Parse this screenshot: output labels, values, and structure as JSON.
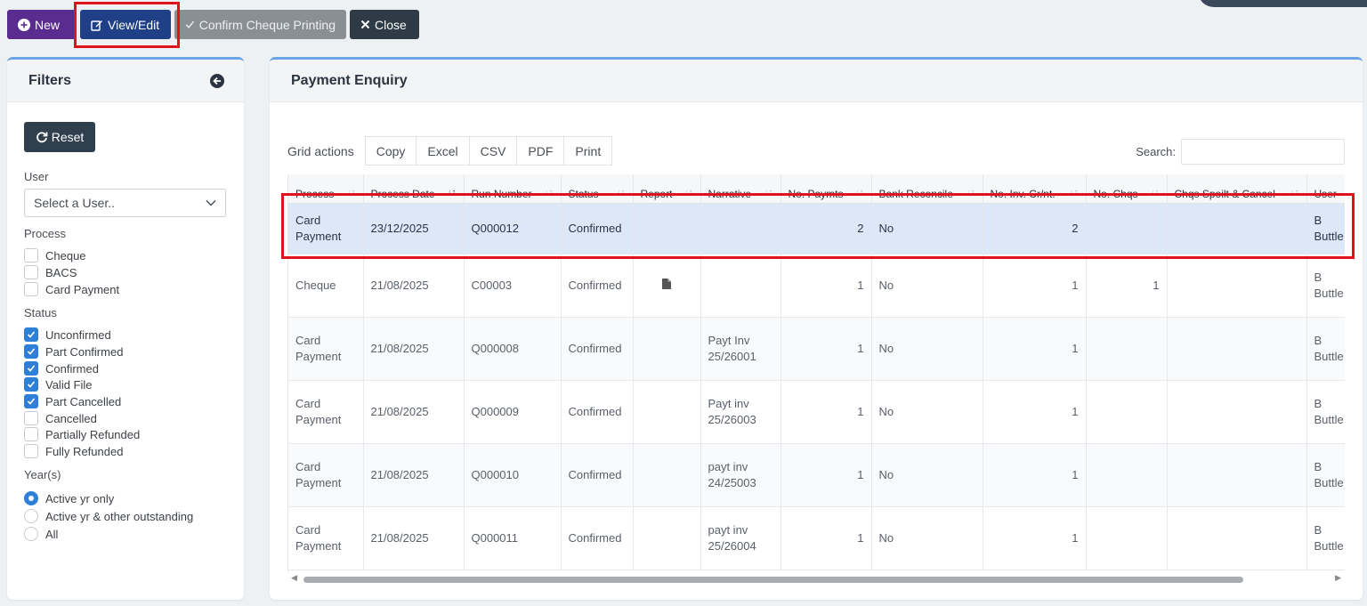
{
  "toolbar": {
    "new_label": "New",
    "view_edit_label": "View/Edit",
    "confirm_label": "Confirm Cheque Printing",
    "close_label": "Close"
  },
  "filters": {
    "title": "Filters",
    "reset_label": "Reset",
    "user_label": "User",
    "user_select": "Select a User..",
    "process_label": "Process",
    "process_options": [
      {
        "label": "Cheque",
        "checked": false
      },
      {
        "label": "BACS",
        "checked": false
      },
      {
        "label": "Card Payment",
        "checked": false
      }
    ],
    "status_label": "Status",
    "status_options": [
      {
        "label": "Unconfirmed",
        "checked": true
      },
      {
        "label": "Part Confirmed",
        "checked": true
      },
      {
        "label": "Confirmed",
        "checked": true
      },
      {
        "label": "Valid File",
        "checked": true
      },
      {
        "label": "Part Cancelled",
        "checked": true
      },
      {
        "label": "Cancelled",
        "checked": false
      },
      {
        "label": "Partially Refunded",
        "checked": false
      },
      {
        "label": "Fully Refunded",
        "checked": false
      }
    ],
    "years_label": "Year(s)",
    "year_options": [
      {
        "label": "Active yr only",
        "selected": true
      },
      {
        "label": "Active yr & other outstanding",
        "selected": false
      },
      {
        "label": "All",
        "selected": false
      }
    ]
  },
  "enquiry": {
    "title": "Payment Enquiry",
    "grid_actions_label": "Grid actions",
    "grid_buttons": [
      "Copy",
      "Excel",
      "CSV",
      "PDF",
      "Print"
    ],
    "search_label": "Search:",
    "columns": [
      "Process",
      "Process Date",
      "Run Number",
      "Status",
      "Report",
      "Narrative",
      "No. Paymts",
      "Bank Reconcile",
      "No. Inv. Cr/nt.",
      "No. Chqs",
      "Chqs Spoilt & Cancel",
      "User"
    ],
    "rows": [
      {
        "process": "Card Payment",
        "date": "23/12/2025",
        "run": "Q000012",
        "status": "Confirmed",
        "report": "",
        "narrative": "",
        "paymts": "2",
        "bank": "No",
        "inv": "2",
        "chqs": "",
        "spoilt": "",
        "user": "B Buttle",
        "selected": true
      },
      {
        "process": "Cheque",
        "date": "21/08/2025",
        "run": "C00003",
        "status": "Confirmed",
        "report": "file-icon",
        "narrative": "",
        "paymts": "1",
        "bank": "No",
        "inv": "1",
        "chqs": "1",
        "spoilt": "",
        "user": "B Buttle",
        "selected": false
      },
      {
        "process": "Card Payment",
        "date": "21/08/2025",
        "run": "Q000008",
        "status": "Confirmed",
        "report": "",
        "narrative": "Payt Inv 25/26001",
        "paymts": "1",
        "bank": "No",
        "inv": "1",
        "chqs": "",
        "spoilt": "",
        "user": "B Buttle",
        "selected": false
      },
      {
        "process": "Card Payment",
        "date": "21/08/2025",
        "run": "Q000009",
        "status": "Confirmed",
        "report": "",
        "narrative": "Payt inv 25/26003",
        "paymts": "1",
        "bank": "No",
        "inv": "1",
        "chqs": "",
        "spoilt": "",
        "user": "B Buttle",
        "selected": false
      },
      {
        "process": "Card Payment",
        "date": "21/08/2025",
        "run": "Q000010",
        "status": "Confirmed",
        "report": "",
        "narrative": "payt inv 24/25003",
        "paymts": "1",
        "bank": "No",
        "inv": "1",
        "chqs": "",
        "spoilt": "",
        "user": "B Buttle",
        "selected": false
      },
      {
        "process": "Card Payment",
        "date": "21/08/2025",
        "run": "Q000011",
        "status": "Confirmed",
        "report": "",
        "narrative": "payt inv 25/26004",
        "paymts": "1",
        "bank": "No",
        "inv": "1",
        "chqs": "",
        "spoilt": "",
        "user": "B Buttle",
        "selected": false
      }
    ]
  },
  "colors": {
    "accent": "#2e7fd8",
    "highlight": "#e1121b",
    "selected_row": "#dce8f7"
  }
}
